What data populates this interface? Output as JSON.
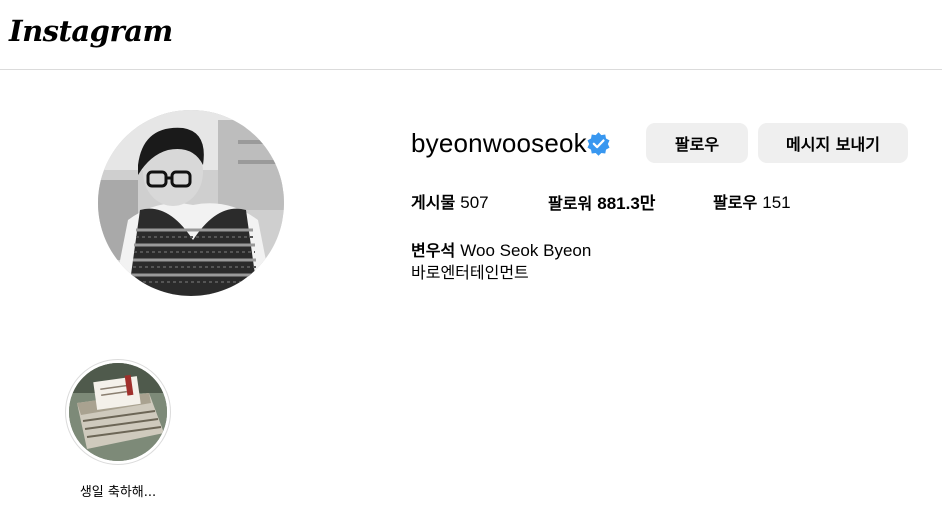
{
  "app": {
    "logo_text": "Instagram"
  },
  "profile": {
    "username": "byeonwooseok",
    "verified": true,
    "follow_button": "팔로우",
    "message_button": "메시지 보내기",
    "stats": [
      {
        "label": "게시물",
        "count": "507"
      },
      {
        "label": "팔로워",
        "count": "881.3만"
      },
      {
        "label": "팔로우",
        "count": "151"
      }
    ],
    "bio": {
      "name_korean": "변우석",
      "name_english": "Woo Seok Byeon",
      "line": "바로엔터테인먼트"
    }
  },
  "highlights": [
    {
      "label": "생일 축하해..."
    }
  ],
  "colors": {
    "button_bg": "#efefef",
    "verified_blue": "#3897f0",
    "divider": "#dbdbdb"
  }
}
